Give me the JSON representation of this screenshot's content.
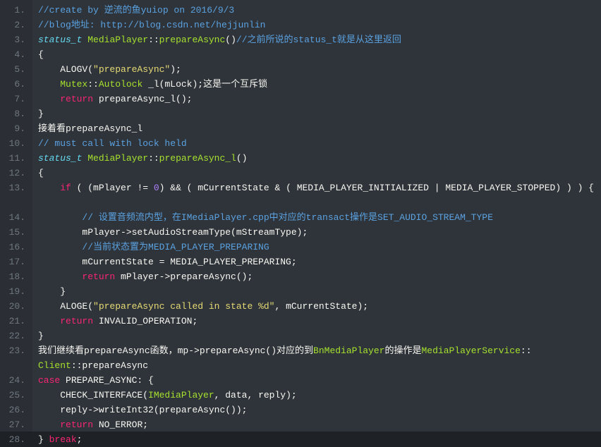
{
  "lines": [
    {
      "n": "1.",
      "h": 1,
      "tokens": [
        {
          "cls": "c-comment",
          "t": "//create by 逆流的鱼yuiop on 2016/9/3"
        }
      ]
    },
    {
      "n": "2.",
      "h": 1,
      "tokens": [
        {
          "cls": "c-comment",
          "t": "//blog地址: http://blog.csdn.net/hejjunlin"
        }
      ]
    },
    {
      "n": "3.",
      "h": 1,
      "tokens": [
        {
          "cls": "c-type",
          "t": "status_t"
        },
        {
          "cls": "c-plain",
          "t": " "
        },
        {
          "cls": "c-classkw",
          "t": "MediaPlayer"
        },
        {
          "cls": "c-plain",
          "t": "::"
        },
        {
          "cls": "c-fn",
          "t": "prepareAsync"
        },
        {
          "cls": "c-plain",
          "t": "()"
        },
        {
          "cls": "c-comment",
          "t": "//之前所说的status_t就是从这里返回"
        }
      ]
    },
    {
      "n": "4.",
      "h": 1,
      "tokens": [
        {
          "cls": "c-plain",
          "t": "{"
        }
      ]
    },
    {
      "n": "5.",
      "h": 1,
      "tokens": [
        {
          "cls": "c-plain",
          "t": "    ALOGV("
        },
        {
          "cls": "c-string",
          "t": "\"prepareAsync\""
        },
        {
          "cls": "c-plain",
          "t": ");"
        }
      ]
    },
    {
      "n": "6.",
      "h": 1,
      "tokens": [
        {
          "cls": "c-plain",
          "t": "    "
        },
        {
          "cls": "c-classkw",
          "t": "Mutex"
        },
        {
          "cls": "c-plain",
          "t": "::"
        },
        {
          "cls": "c-classkw",
          "t": "Autolock"
        },
        {
          "cls": "c-plain",
          "t": " _l(mLock);这是一个互斥锁"
        }
      ]
    },
    {
      "n": "7.",
      "h": 1,
      "tokens": [
        {
          "cls": "c-plain",
          "t": "    "
        },
        {
          "cls": "c-keyword",
          "t": "return"
        },
        {
          "cls": "c-plain",
          "t": " prepareAsync_l();"
        }
      ]
    },
    {
      "n": "8.",
      "h": 1,
      "tokens": [
        {
          "cls": "c-plain",
          "t": "}"
        }
      ]
    },
    {
      "n": "9.",
      "h": 1,
      "tokens": [
        {
          "cls": "c-plain",
          "t": "接着看prepareAsync_l"
        }
      ]
    },
    {
      "n": "10.",
      "h": 1,
      "tokens": [
        {
          "cls": "c-comment",
          "t": "// must call with lock held"
        }
      ]
    },
    {
      "n": "11.",
      "h": 1,
      "tokens": [
        {
          "cls": "c-type",
          "t": "status_t"
        },
        {
          "cls": "c-plain",
          "t": " "
        },
        {
          "cls": "c-classkw",
          "t": "MediaPlayer"
        },
        {
          "cls": "c-plain",
          "t": "::"
        },
        {
          "cls": "c-fn",
          "t": "prepareAsync_l"
        },
        {
          "cls": "c-plain",
          "t": "()"
        }
      ]
    },
    {
      "n": "12.",
      "h": 1,
      "tokens": [
        {
          "cls": "c-plain",
          "t": "{"
        }
      ]
    },
    {
      "n": "13.",
      "h": 2,
      "tokens": [
        {
          "cls": "c-plain",
          "t": "    "
        },
        {
          "cls": "c-keyword",
          "t": "if"
        },
        {
          "cls": "c-plain",
          "t": " ( (mPlayer != "
        },
        {
          "cls": "c-num",
          "t": "0"
        },
        {
          "cls": "c-plain",
          "t": ") && ( mCurrentState & ( MEDIA_PLAYER_INITIALIZED | MEDIA_PLAYER_STOPPED) ) ) {"
        }
      ]
    },
    {
      "n": "14.",
      "h": 1,
      "tokens": [
        {
          "cls": "c-plain",
          "t": "        "
        },
        {
          "cls": "c-comment",
          "t": "// 设置音频流内型，在IMediaPlayer.cpp中对应的transact操作是SET_AUDIO_STREAM_TYPE"
        }
      ]
    },
    {
      "n": "15.",
      "h": 1,
      "tokens": [
        {
          "cls": "c-plain",
          "t": "        mPlayer->setAudioStreamType(mStreamType);"
        }
      ]
    },
    {
      "n": "16.",
      "h": 1,
      "tokens": [
        {
          "cls": "c-plain",
          "t": "        "
        },
        {
          "cls": "c-comment",
          "t": "//当前状态置为MEDIA_PLAYER_PREPARING"
        }
      ]
    },
    {
      "n": "17.",
      "h": 1,
      "tokens": [
        {
          "cls": "c-plain",
          "t": "        mCurrentState = MEDIA_PLAYER_PREPARING;"
        }
      ]
    },
    {
      "n": "18.",
      "h": 1,
      "tokens": [
        {
          "cls": "c-plain",
          "t": "        "
        },
        {
          "cls": "c-keyword",
          "t": "return"
        },
        {
          "cls": "c-plain",
          "t": " mPlayer->prepareAsync();"
        }
      ]
    },
    {
      "n": "19.",
      "h": 1,
      "tokens": [
        {
          "cls": "c-plain",
          "t": "    }"
        }
      ]
    },
    {
      "n": "20.",
      "h": 1,
      "tokens": [
        {
          "cls": "c-plain",
          "t": "    ALOGE("
        },
        {
          "cls": "c-string",
          "t": "\"prepareAsync called in state %d\""
        },
        {
          "cls": "c-plain",
          "t": ", mCurrentState);"
        }
      ]
    },
    {
      "n": "21.",
      "h": 1,
      "tokens": [
        {
          "cls": "c-plain",
          "t": "    "
        },
        {
          "cls": "c-keyword",
          "t": "return"
        },
        {
          "cls": "c-plain",
          "t": " INVALID_OPERATION;"
        }
      ]
    },
    {
      "n": "22.",
      "h": 1,
      "tokens": [
        {
          "cls": "c-plain",
          "t": "}"
        }
      ]
    },
    {
      "n": "23.",
      "h": 2,
      "tokens": [
        {
          "cls": "c-plain",
          "t": "我们继续看prepareAsync函数，mp->prepareAsync()对应的到"
        },
        {
          "cls": "c-classkw",
          "t": "BnMediaPlayer"
        },
        {
          "cls": "c-plain",
          "t": "的操作是"
        },
        {
          "cls": "c-classkw",
          "t": "MediaPlayerService"
        },
        {
          "cls": "c-plain",
          "t": "::"
        },
        {
          "cls": "c-classkw",
          "t": "Client"
        },
        {
          "cls": "c-plain",
          "t": "::prepareAsync"
        }
      ]
    },
    {
      "n": "24.",
      "h": 1,
      "tokens": [
        {
          "cls": "c-keyword",
          "t": "case"
        },
        {
          "cls": "c-plain",
          "t": " PREPARE_ASYNC: {"
        }
      ]
    },
    {
      "n": "25.",
      "h": 1,
      "tokens": [
        {
          "cls": "c-plain",
          "t": "    CHECK_INTERFACE("
        },
        {
          "cls": "c-classkw",
          "t": "IMediaPlayer"
        },
        {
          "cls": "c-plain",
          "t": ", data, reply);"
        }
      ]
    },
    {
      "n": "26.",
      "h": 1,
      "tokens": [
        {
          "cls": "c-plain",
          "t": "    reply->writeInt32(prepareAsync());"
        }
      ]
    },
    {
      "n": "27.",
      "h": 1,
      "tokens": [
        {
          "cls": "c-plain",
          "t": "    "
        },
        {
          "cls": "c-keyword",
          "t": "return"
        },
        {
          "cls": "c-plain",
          "t": " NO_ERROR;"
        }
      ]
    },
    {
      "n": "28.",
      "h": 1,
      "tokens": [
        {
          "cls": "c-plain",
          "t": "} "
        },
        {
          "cls": "c-keyword",
          "t": "break"
        },
        {
          "cls": "c-plain",
          "t": ";"
        }
      ]
    }
  ]
}
